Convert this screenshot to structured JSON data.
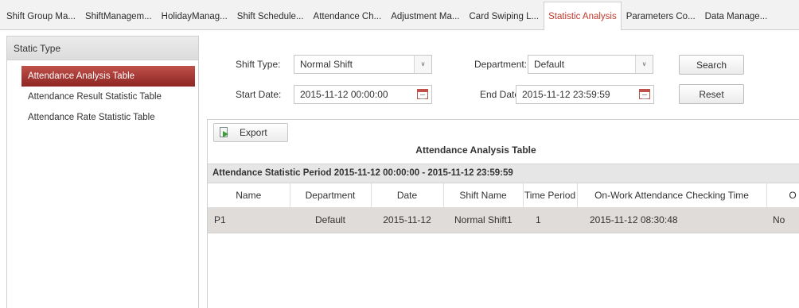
{
  "tabs": [
    {
      "label": "Shift Group Ma...",
      "active": false
    },
    {
      "label": "ShiftManagem...",
      "active": false
    },
    {
      "label": "HolidayManag...",
      "active": false
    },
    {
      "label": "Shift Schedule...",
      "active": false
    },
    {
      "label": "Attendance Ch...",
      "active": false
    },
    {
      "label": "Adjustment Ma...",
      "active": false
    },
    {
      "label": "Card Swiping L...",
      "active": true
    },
    {
      "label": "Statistic Analysis",
      "active": true
    },
    {
      "label": "Parameters Co...",
      "active": false
    },
    {
      "label": "Data Manage...",
      "active": false
    }
  ],
  "sidebar": {
    "header": "Static Type",
    "items": [
      {
        "label": "Attendance Analysis Table",
        "active": true
      },
      {
        "label": "Attendance Result Statistic Table",
        "active": false
      },
      {
        "label": "Attendance Rate Statistic Table",
        "active": false
      }
    ]
  },
  "filters": {
    "shift_type_label": "Shift Type:",
    "shift_type_value": "Normal Shift",
    "department_label": "Department:",
    "department_value": "Default",
    "start_date_label": "Start Date:",
    "start_date_value": "2015-11-12 00:00:00",
    "end_date_label": "End Date:",
    "end_date_value": "2015-11-12 23:59:59",
    "search_label": "Search",
    "reset_label": "Reset"
  },
  "result": {
    "export_label": "Export",
    "title": "Attendance Analysis Table",
    "period": "Attendance Statistic Period 2015-11-12 00:00:00 - 2015-11-12 23:59:59",
    "columns": [
      "Name",
      "Department",
      "Date",
      "Shift Name",
      "Time Period",
      "On-Work Attendance Checking Time",
      "O"
    ],
    "rows": [
      [
        "P1",
        "Default",
        "2015-11-12",
        "Normal Shift1",
        "1",
        "2015-11-12 08:30:48",
        "No"
      ]
    ]
  },
  "colors": {
    "accent": "#c0392b",
    "selected_nav": "#a0302c",
    "row_highlight": "#dfdcd9"
  }
}
